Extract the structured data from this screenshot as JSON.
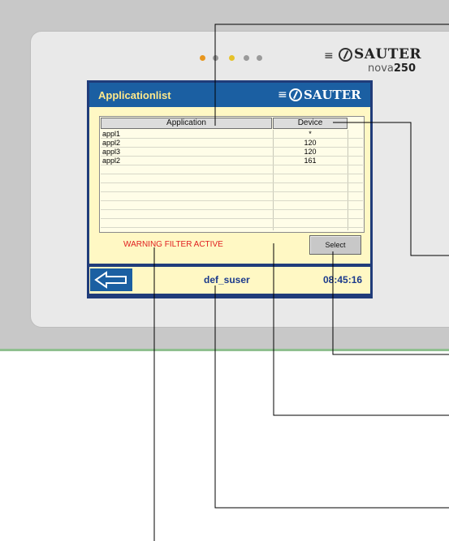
{
  "device": {
    "brand": "SAUTER",
    "model_prefix": "nova",
    "model_number": "250",
    "led_colors": [
      "#e8961e",
      "#9a9a9a",
      "#e6c22a",
      "#9a9a9a",
      "#9a9a9a"
    ]
  },
  "screen": {
    "title": "Applicationlist",
    "logo_text": "SAUTER",
    "table": {
      "columns": [
        "Application",
        "Device"
      ],
      "rows": [
        {
          "application": "appl1",
          "device": "*"
        },
        {
          "application": "appl2",
          "device": "120"
        },
        {
          "application": "appl3",
          "device": "120"
        },
        {
          "application": "appl2",
          "device": "161"
        }
      ]
    },
    "warning": "WARNING FILTER ACTIVE",
    "select_label": "Select",
    "user": "def_suser",
    "time": "08:45:16"
  },
  "colors": {
    "title_bar": "#1b5fa2",
    "content_bg": "#fff8c4",
    "warning_text": "#e02020"
  },
  "icons": {
    "back": "left-arrow-icon",
    "logo": "sauter-logo-icon"
  }
}
